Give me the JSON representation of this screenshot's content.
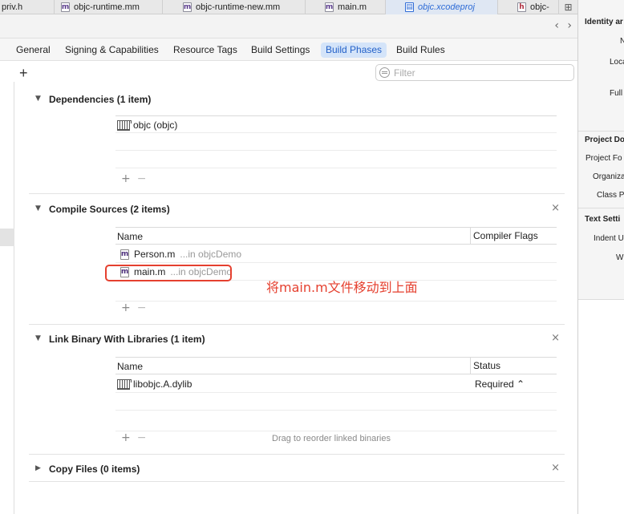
{
  "tabs": [
    {
      "label": "priv.h",
      "icon": "h"
    },
    {
      "label": "objc-runtime.mm",
      "icon": "m"
    },
    {
      "label": "objc-runtime-new.mm",
      "icon": "m"
    },
    {
      "label": "main.m",
      "icon": "m"
    },
    {
      "label": "objc.xcodeproj",
      "icon": "proj"
    },
    {
      "label": "objc-",
      "icon": "h"
    }
  ],
  "nav": {
    "arrows": "‹ ›"
  },
  "editor_tabs": [
    {
      "label": "General"
    },
    {
      "label": "Signing & Capabilities"
    },
    {
      "label": "Resource Tags"
    },
    {
      "label": "Build Settings"
    },
    {
      "label": "Build Phases"
    },
    {
      "label": "Build Rules"
    }
  ],
  "toolbar": {
    "add_label": "+",
    "filter_placeholder": "Filter"
  },
  "phases": {
    "dependencies": {
      "title": "Dependencies (1 item)",
      "rows": [
        {
          "name": "objc (objc)"
        }
      ]
    },
    "compile": {
      "title": "Compile Sources (2 items)",
      "col_name": "Name",
      "col_flags": "Compiler Flags",
      "rows": [
        {
          "name": "Person.m",
          "location": "...in objcDemo"
        },
        {
          "name": "main.m",
          "location": "...in objcDemo"
        }
      ]
    },
    "link": {
      "title": "Link Binary With Libraries (1 item)",
      "col_name": "Name",
      "col_status": "Status",
      "rows": [
        {
          "name": "libobjc.A.dylib",
          "status": "Required ⌃"
        }
      ],
      "drag_hint": "Drag to reorder linked binaries"
    },
    "copy": {
      "title": "Copy Files (0 items)"
    }
  },
  "controls": {
    "close": "×",
    "plus": "+",
    "minus": "−"
  },
  "annotation": {
    "text": "将main.m文件移动到上面"
  },
  "inspector": {
    "identity_title": "Identity ar",
    "identity_labels": [
      "N",
      "Loca",
      "Full"
    ],
    "project_doc_title": "Project Do",
    "project_doc_labels": [
      "Project Fo",
      "Organiza",
      "Class P"
    ],
    "text_settings_title": "Text Setti",
    "text_settings_labels": [
      "Indent U",
      "Wi"
    ]
  }
}
